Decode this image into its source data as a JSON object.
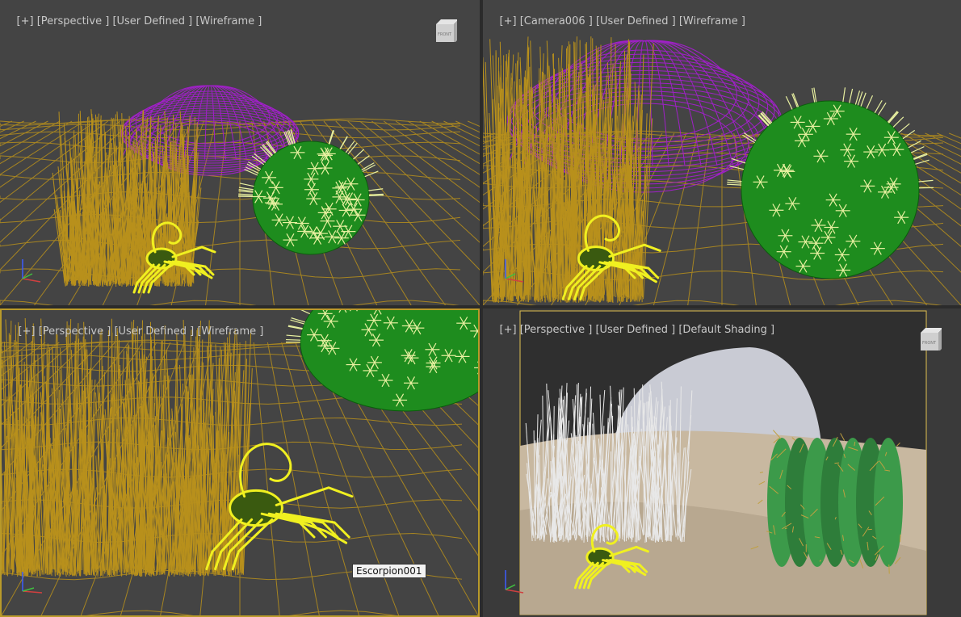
{
  "viewports": {
    "top_left": {
      "plus": "[+]",
      "view": "[Perspective ]",
      "mode": "[User Defined ]",
      "shading": "[Wireframe ]",
      "cube_label": "FRONT"
    },
    "top_right": {
      "plus": "[+]",
      "view": "[Camera006 ]",
      "mode": "[User Defined ]",
      "shading": "[Wireframe ]"
    },
    "bottom_left": {
      "plus": "[+]",
      "view": "[Perspective ]",
      "mode": "[User Defined ]",
      "shading": "[Wireframe ]"
    },
    "bottom_right": {
      "plus": "[+]",
      "view": "[Perspective ]",
      "mode": "[User Defined ]",
      "shading": "[Default Shading ]",
      "cube_label": "FRONT"
    }
  },
  "tooltip": "Escorpion001",
  "colors": {
    "viewport_bg": "#444444",
    "grass": "#b8901c",
    "rock_wire": "#a020c8",
    "cactus": "#1e8c1e",
    "spines": "#e8f0a0",
    "scorpion_sel": "#f0f020",
    "active_border": "#b99a2a"
  }
}
